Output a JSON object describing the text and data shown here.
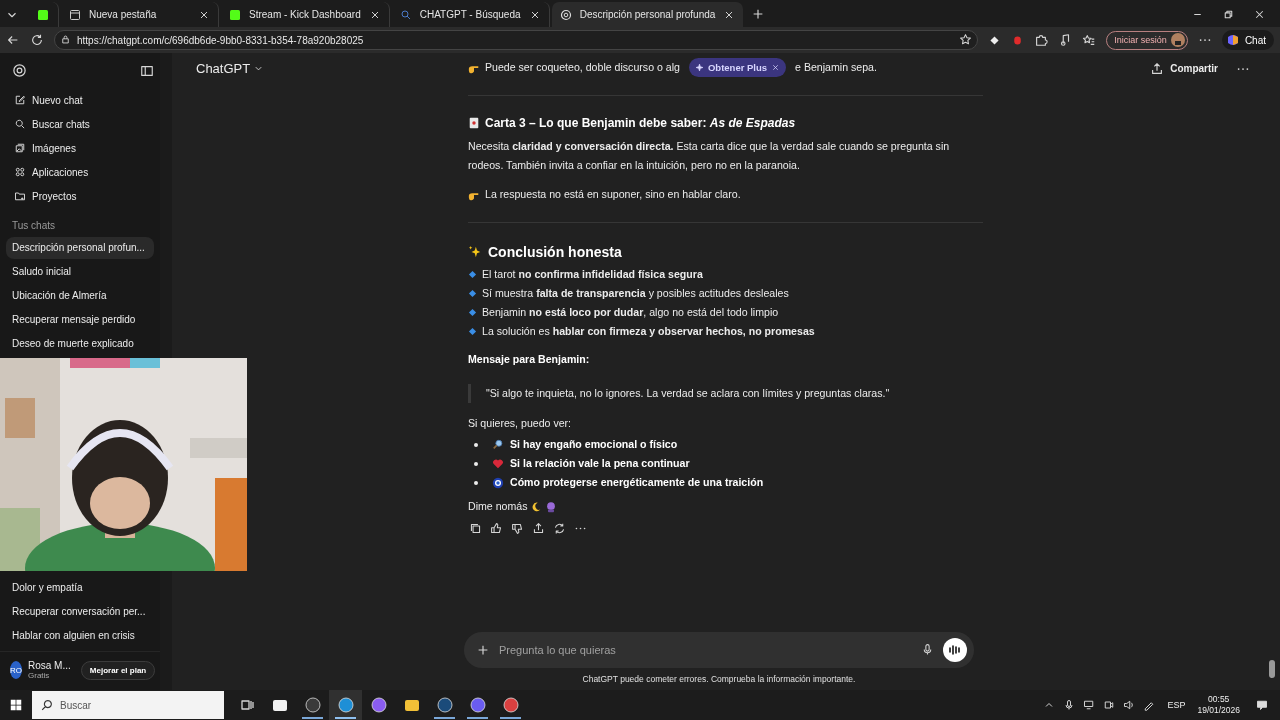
{
  "browser": {
    "tabs": [
      {
        "kind": "kick",
        "selected": false
      },
      {
        "kind": "page",
        "title": "Nueva pestaña",
        "selected": false
      },
      {
        "kind": "kick",
        "title": "Stream - Kick Dashboard",
        "selected": false
      },
      {
        "kind": "search",
        "title": "CHATGPT - Búsqueda",
        "selected": false
      },
      {
        "kind": "openai",
        "title": "Descripción personal profunda",
        "selected": true
      }
    ],
    "address": "https://chatgpt.com/c/696db6de-9bb0-8331-b354-78a920b28025",
    "sign_in": "Iniciar sesión",
    "copilot": "Chat"
  },
  "sidebar": {
    "nav": [
      {
        "kind": "compose",
        "label": "Nuevo chat"
      },
      {
        "kind": "search",
        "label": "Buscar chats"
      },
      {
        "kind": "images",
        "label": "Imágenes"
      },
      {
        "kind": "apps",
        "label": "Aplicaciones"
      },
      {
        "kind": "folder",
        "label": "Proyectos"
      }
    ],
    "section": "Tus chats",
    "chats": [
      {
        "label": "Descripción personal profun...",
        "selected": true
      },
      {
        "label": "Saludo inicial",
        "selected": false
      },
      {
        "label": "Ubicación de Almería",
        "selected": false
      },
      {
        "label": "Recuperar mensaje perdido",
        "selected": false
      },
      {
        "label": "Deseo de muerte explicado",
        "selected": false
      }
    ],
    "chats_lower": [
      {
        "label": "Dolor y empatía",
        "selected": false
      },
      {
        "label": "Recuperar conversación per...",
        "selected": false
      },
      {
        "label": "Hablar con alguien en crisis",
        "selected": false
      }
    ],
    "user": {
      "initials": "RO",
      "name": "Rosa M...",
      "plan": "Gratis"
    },
    "upgrade": "Mejorar el plan"
  },
  "header": {
    "model": "ChatGPT",
    "share": "Compartir",
    "promo": "Obtener Plus"
  },
  "conversation": {
    "blocks": [
      {
        "kind": "tip_covered",
        "parts": [
          "Puede ser coqueteo, doble discurso o alg",
          "e Benjamin sepa."
        ]
      },
      {
        "kind": "rule"
      },
      {
        "kind": "card_heading",
        "text": "Carta 3 – Lo que Benjamin debe saber: *As de Espadas*"
      },
      {
        "kind": "para",
        "text": "Necesita **claridad y conversación directa.** Esta carta dice que la verdad sale cuando se pregunta sin rodeos. También invita a confiar en la intuición, pero no en la paranoia."
      },
      {
        "kind": "tip",
        "parts": [
          "La respuesta no está en suponer, sino en hablar claro."
        ]
      },
      {
        "kind": "rule"
      },
      {
        "kind": "heading",
        "text": "Conclusión honesta"
      },
      {
        "kind": "bullets",
        "items": [
          "El tarot **no confirma infidelidad física segura**",
          "Sí muestra **falta de transparencia** y posibles actitudes desleales",
          "Benjamin **no está loco por dudar**, algo no está del todo limpio",
          "La solución es **hablar con firmeza y observar hechos, no promesas**"
        ]
      },
      {
        "kind": "label",
        "text": "Mensaje para Benjamin:"
      },
      {
        "kind": "quote",
        "text": "\"Si algo te inquieta, no lo ignores. La verdad se aclara con límites y preguntas claras.\""
      },
      {
        "kind": "para",
        "text": "Si quieres, puedo ver:"
      },
      {
        "kind": "options",
        "items": [
          {
            "kind": "magnifier",
            "text": "Si hay engaño emocional o físico"
          },
          {
            "kind": "heart",
            "text": "Si la relación vale la pena continuar"
          },
          {
            "kind": "nazar",
            "text": "Cómo protegerse energéticamente de una traición"
          }
        ]
      },
      {
        "kind": "sign_off",
        "text": "Dime nomás"
      },
      {
        "kind": "actions"
      }
    ]
  },
  "composer": {
    "placeholder": "Pregunta lo que quieras"
  },
  "disclaimer": "ChatGPT puede cometer errores. Comprueba la información importante.",
  "taskbar": {
    "search_placeholder": "Buscar",
    "apps": [
      {
        "kind": "taskview",
        "running": false,
        "selected": false
      },
      {
        "kind": "store",
        "running": false,
        "selected": false
      },
      {
        "kind": "obs",
        "running": true,
        "selected": false
      },
      {
        "kind": "edge",
        "running": true,
        "selected": true
      },
      {
        "kind": "copilot",
        "running": false,
        "selected": false
      },
      {
        "kind": "explorer",
        "running": false,
        "selected": false
      },
      {
        "kind": "steam",
        "running": true,
        "selected": false
      },
      {
        "kind": "discord",
        "running": true,
        "selected": false
      },
      {
        "kind": "anki",
        "running": true,
        "selected": false
      }
    ],
    "language": "ESP",
    "time": "00:55",
    "date": "19/01/2026"
  }
}
